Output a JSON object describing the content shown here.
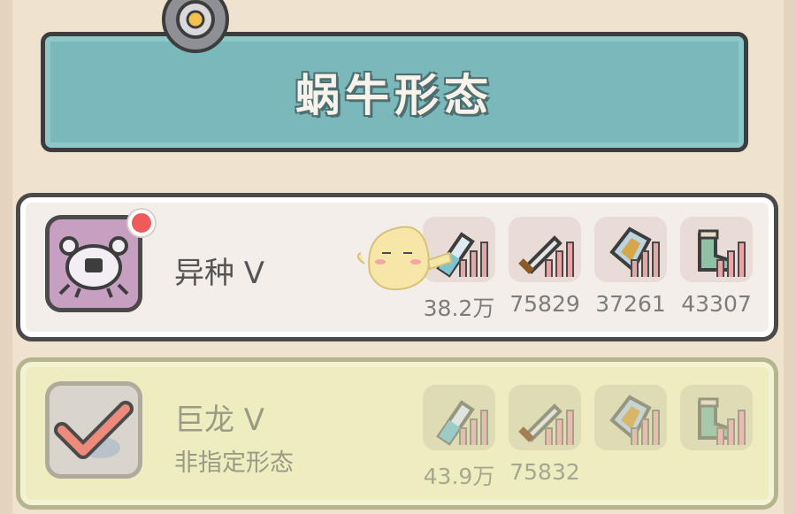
{
  "title": "蜗牛形态",
  "forms": [
    {
      "name": "异种 V",
      "subtitle": "",
      "has_notification": true,
      "avatar_icon": "crab-icon",
      "stats": [
        {
          "icon": "potion-icon",
          "value": "38.2万"
        },
        {
          "icon": "sword-icon",
          "value": "75829"
        },
        {
          "icon": "shield-icon",
          "value": "37261"
        },
        {
          "icon": "boot-icon",
          "value": "43307"
        }
      ]
    },
    {
      "name": "巨龙 V",
      "subtitle": "非指定形态",
      "has_notification": false,
      "avatar_icon": "checkmark-icon",
      "stats": [
        {
          "icon": "potion-icon",
          "value": "43.9万"
        },
        {
          "icon": "sword-icon",
          "value": "75832"
        },
        {
          "icon": "shield-icon",
          "value": ""
        },
        {
          "icon": "boot-icon",
          "value": ""
        }
      ]
    }
  ]
}
